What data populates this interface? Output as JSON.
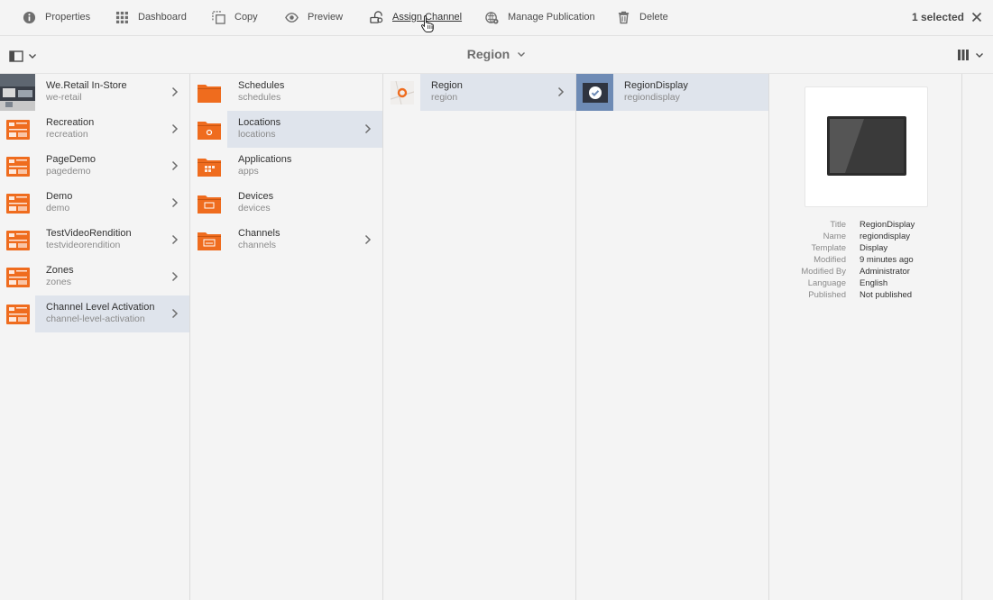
{
  "actions": {
    "properties": "Properties",
    "dashboard": "Dashboard",
    "copy": "Copy",
    "preview": "Preview",
    "assign_channel": "Assign Channel",
    "manage_publication": "Manage Publication",
    "delete": "Delete"
  },
  "selection": {
    "count_label": "1 selected"
  },
  "breadcrumb": {
    "title": "Region"
  },
  "columns": {
    "projects": [
      {
        "title": "We.Retail In-Store",
        "name": "we-retail"
      },
      {
        "title": "Recreation",
        "name": "recreation"
      },
      {
        "title": "PageDemo",
        "name": "pagedemo"
      },
      {
        "title": "Demo",
        "name": "demo"
      },
      {
        "title": "TestVideoRendition",
        "name": "testvideorendition"
      },
      {
        "title": "Zones",
        "name": "zones"
      },
      {
        "title": "Channel Level Activation",
        "name": "channel-level-activation"
      }
    ],
    "folders": [
      {
        "title": "Schedules",
        "name": "schedules"
      },
      {
        "title": "Locations",
        "name": "locations"
      },
      {
        "title": "Applications",
        "name": "apps"
      },
      {
        "title": "Devices",
        "name": "devices"
      },
      {
        "title": "Channels",
        "name": "channels"
      }
    ],
    "locations": [
      {
        "title": "Region",
        "name": "region"
      }
    ],
    "region": [
      {
        "title": "RegionDisplay",
        "name": "regiondisplay"
      }
    ]
  },
  "details": {
    "rows": [
      {
        "key": "Title",
        "value": "RegionDisplay"
      },
      {
        "key": "Name",
        "value": "regiondisplay"
      },
      {
        "key": "Template",
        "value": "Display"
      },
      {
        "key": "Modified",
        "value": "9 minutes ago"
      },
      {
        "key": "Modified By",
        "value": "Administrator"
      },
      {
        "key": "Language",
        "value": "English"
      },
      {
        "key": "Published",
        "value": "Not published"
      }
    ]
  },
  "colors": {
    "accent_orange": "#ef6c1e",
    "selected_bg": "#dfe4ec",
    "check_blue": "#6e8bb5"
  },
  "icons": [
    "info-icon",
    "dashboard-grid-icon",
    "copy-icon",
    "eye-icon",
    "assign-channel-icon",
    "manage-publication-icon",
    "trash-icon",
    "close-icon",
    "rail-toggle-icon",
    "chevron-down-icon",
    "column-view-icon",
    "chevron-right-icon",
    "folder-icon",
    "project-thumbnail-icon",
    "location-icon",
    "check-icon"
  ]
}
